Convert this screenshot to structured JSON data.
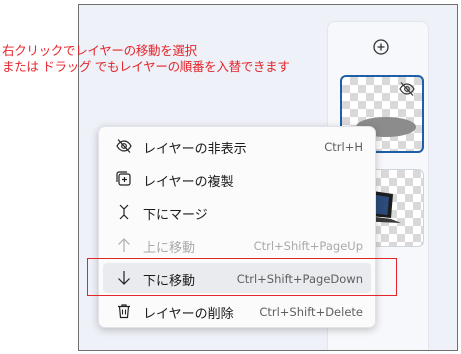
{
  "annotation": {
    "line1": "右クリックでレイヤーの移動を選択",
    "line2": "または  ドラッグ でもレイヤーの順番を入替できます"
  },
  "colors": {
    "accent": "#1f5ea8",
    "annotation": "#e4252b",
    "menu_bg": "#fbfbfc"
  },
  "context_menu": {
    "items": [
      {
        "label": "レイヤーの非表示",
        "shortcut": "Ctrl+H",
        "icon": "eye-off-icon",
        "enabled": true
      },
      {
        "label": "レイヤーの複製",
        "shortcut": "",
        "icon": "duplicate-icon",
        "enabled": true
      },
      {
        "label": "下にマージ",
        "shortcut": "",
        "icon": "merge-down-icon",
        "enabled": true
      },
      {
        "label": "上に移動",
        "shortcut": "Ctrl+Shift+PageUp",
        "icon": "arrow-up-icon",
        "enabled": false
      },
      {
        "label": "下に移動",
        "shortcut": "Ctrl+Shift+PageDown",
        "icon": "arrow-down-icon",
        "enabled": true
      },
      {
        "label": "レイヤーの削除",
        "shortcut": "Ctrl+Shift+Delete",
        "icon": "trash-icon",
        "enabled": true
      }
    ]
  },
  "layers_panel": {
    "add_icon": "plus-circle-icon",
    "layers": [
      {
        "selected": true,
        "hidden": true,
        "content": "gray-ellipse"
      },
      {
        "selected": false,
        "hidden": false,
        "content": "laptop-photo"
      }
    ]
  }
}
